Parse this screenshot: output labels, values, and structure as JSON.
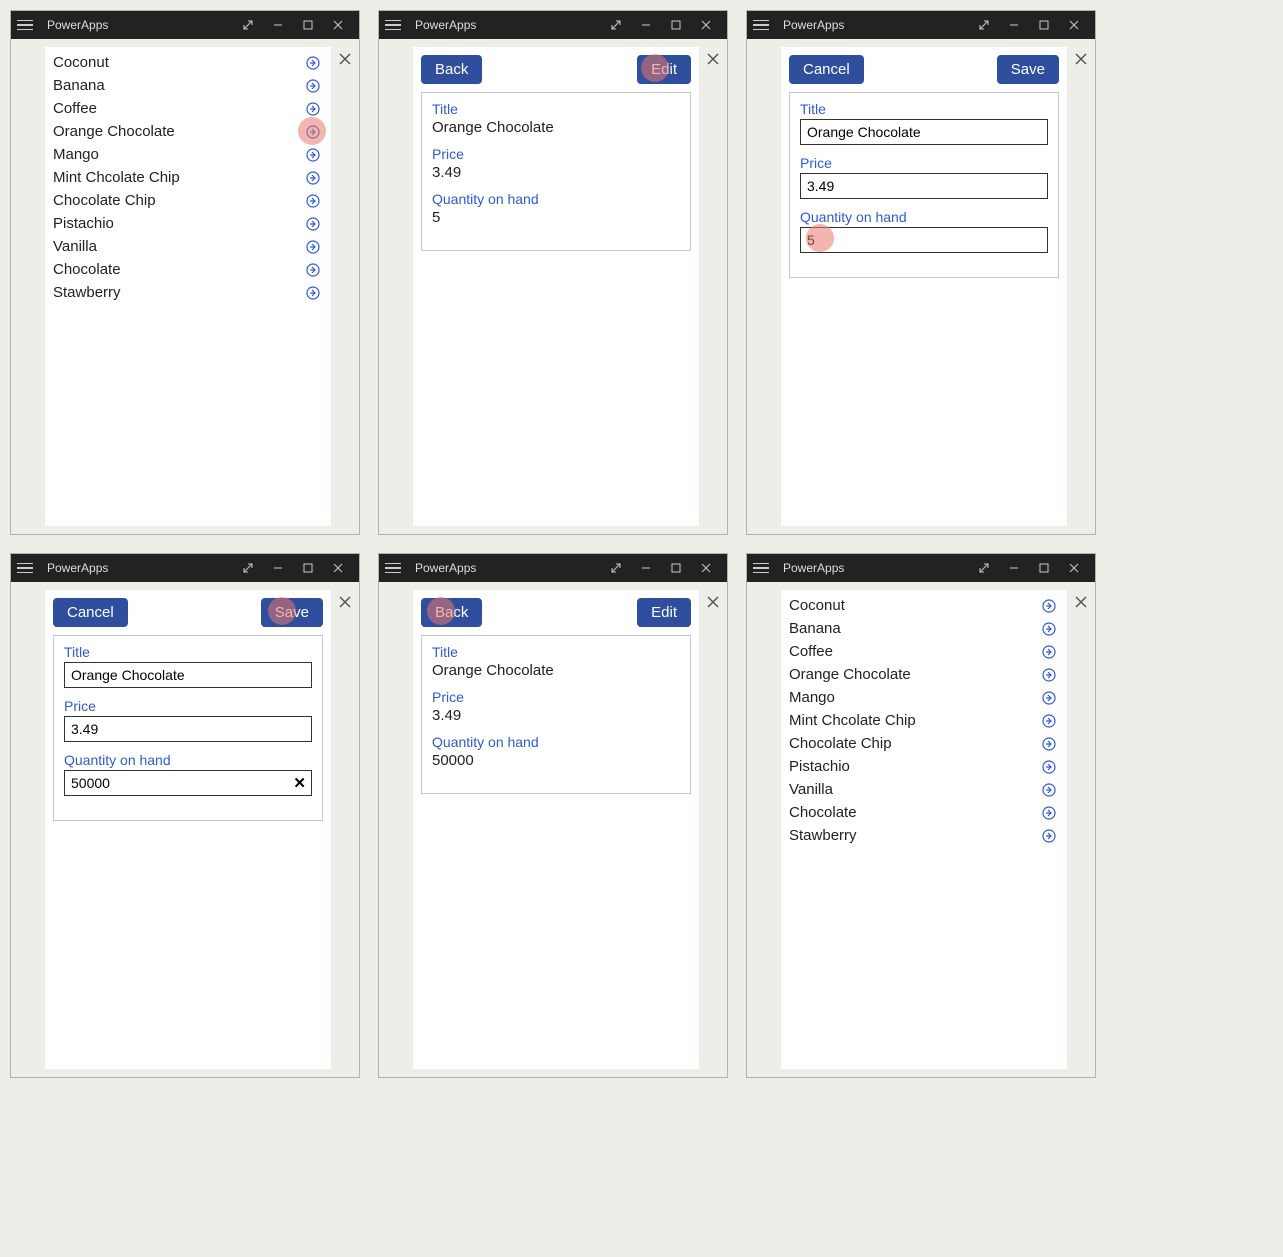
{
  "app_title": "PowerApps",
  "buttons": {
    "back": "Back",
    "edit": "Edit",
    "cancel": "Cancel",
    "save": "Save"
  },
  "labels": {
    "title": "Title",
    "price": "Price",
    "qty": "Quantity on hand"
  },
  "flavors": [
    "Coconut",
    "Banana",
    "Coffee",
    "Orange Chocolate",
    "Mango",
    "Mint Chcolate Chip",
    "Chocolate Chip",
    "Pistachio",
    "Vanilla",
    "Chocolate",
    "Stawberry"
  ],
  "detail": {
    "title": "Orange Chocolate",
    "price": "3.49",
    "qty": "5"
  },
  "edited": {
    "title": "Orange Chocolate",
    "price": "3.49",
    "qty": "50000"
  },
  "detail_after": {
    "title": "Orange Chocolate",
    "price": "3.49",
    "qty": "50000"
  }
}
